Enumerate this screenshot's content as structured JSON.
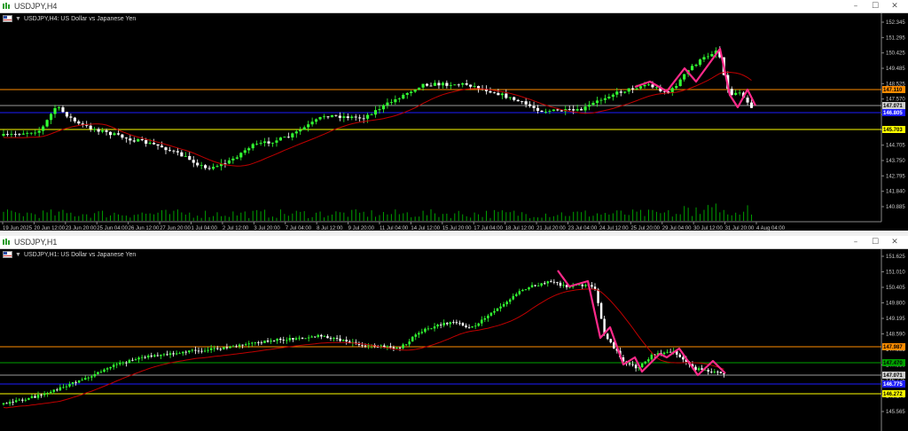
{
  "top_window": {
    "title": "USDJPY,H4",
    "header": "USDJPY,H4:  US Dollar vs Japanese Yen",
    "price_axis": [
      "152.345",
      "151.295",
      "150.425",
      "149.485",
      "148.525",
      "147.570",
      "146.655",
      "145.705",
      "144.705",
      "143.750",
      "142.795",
      "141.840",
      "140.885"
    ],
    "time_axis": [
      "19 Jun 2025",
      "20 Jun 12:00",
      "23 Jun 20:00",
      "25 Jun 04:00",
      "26 Jun 12:00",
      "27 Jun 20:00",
      "1 Jul 04:00",
      "2 Jul 12:00",
      "3 Jul 20:00",
      "7 Jul 04:00",
      "8 Jul 12:00",
      "9 Jul 20:00",
      "11 Jul 04:00",
      "14 Jul 12:00",
      "15 Jul 20:00",
      "17 Jul 04:00",
      "18 Jul 12:00",
      "21 Jul 20:00",
      "23 Jul 04:00",
      "24 Jul 12:00",
      "25 Jul 20:00",
      "29 Jul 04:00",
      "30 Jul 12:00",
      "31 Jul 20:00",
      "4 Aug 04:00"
    ],
    "price_tags": [
      {
        "text": "147.110",
        "bg": "#ff8c00",
        "fg": "#000"
      },
      {
        "text": "147.071",
        "bg": "#cfcfcf",
        "fg": "#000"
      },
      {
        "text": "146.805",
        "bg": "#1c1cff",
        "fg": "#fff"
      },
      {
        "text": "145.703",
        "bg": "#ffff00",
        "fg": "#000"
      }
    ]
  },
  "bottom_window": {
    "title": "USDJPY,H1",
    "header": "USDJPY,H1:  US Dollar vs Japanese Yen",
    "price_axis": [
      "151.625",
      "151.010",
      "150.405",
      "149.800",
      "149.195",
      "148.590",
      "147.985",
      "147.380",
      "146.775",
      "146.170",
      "145.565"
    ],
    "price_tags": [
      {
        "text": "147.987",
        "bg": "#ff8c00",
        "fg": "#000"
      },
      {
        "text": "147.470",
        "bg": "#00a000",
        "fg": "#000"
      },
      {
        "text": "147.071",
        "bg": "#cfcfcf",
        "fg": "#000"
      },
      {
        "text": "146.775",
        "bg": "#1c1cff",
        "fg": "#fff"
      },
      {
        "text": "146.272",
        "bg": "#ffff00",
        "fg": "#000"
      }
    ]
  },
  "controls": {
    "minimize": "–",
    "maximize": "☐",
    "close": "✕"
  },
  "colors": {
    "bull": "#33ff33",
    "bear": "#ffffff",
    "ma": "#c00000",
    "zigzag": "#ff2a8a",
    "orange": "#ff8c00",
    "blue": "#1c1cff",
    "yellow": "#ffff00",
    "green": "#00a000",
    "grey": "#9a9a9a"
  }
}
